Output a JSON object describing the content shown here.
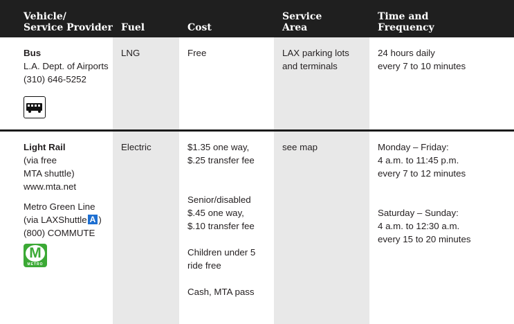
{
  "headers": {
    "vehicle_l1": "Vehicle/",
    "vehicle_l2": "Service Provider",
    "fuel": "Fuel",
    "cost": "Cost",
    "area_l1": "Service",
    "area_l2": "Area",
    "time_l1": "Time and",
    "time_l2": "Frequency"
  },
  "bus": {
    "name": "Bus",
    "provider": "L.A. Dept. of Airports",
    "phone": "(310) 646-5252",
    "icon": "bus-icon",
    "fuel": "LNG",
    "cost": "Free",
    "area_l1": "LAX parking lots",
    "area_l2": "and terminals",
    "time_l1": "24 hours daily",
    "time_l2": "every 7 to 10 minutes"
  },
  "rail": {
    "name": "Light Rail",
    "via1": "(via free",
    "via2": "MTA shuttle)",
    "web": "www.mta.net",
    "line_name": "Metro Green Line",
    "via_lax_prefix": "(via LAXShuttle",
    "badge": "A",
    "via_lax_suffix": ")",
    "phone": "(800) COMMUTE",
    "logo_letter": "M",
    "logo_word": "METRO",
    "logo_color": "#3ba935",
    "badge_color": "#1d6fd1",
    "fuel": "Electric",
    "cost_1a": "$1.35 one way,",
    "cost_1b": "$.25 transfer fee",
    "cost_2a": "Senior/disabled",
    "cost_2b": "$.45 one way,",
    "cost_2c": "$.10 transfer fee",
    "cost_3a": "Children under 5",
    "cost_3b": "ride free",
    "cost_4": "Cash, MTA pass",
    "area": "see map",
    "wk_days": "Monday – Friday:",
    "wk_hours": "4 a.m. to 11:45 p.m.",
    "wk_freq": "every 7 to 12 minutes",
    "we_days": "Saturday – Sunday:",
    "we_hours": "4 a.m. to 12:30 a.m.",
    "we_freq": "every 15 to 20 minutes"
  }
}
